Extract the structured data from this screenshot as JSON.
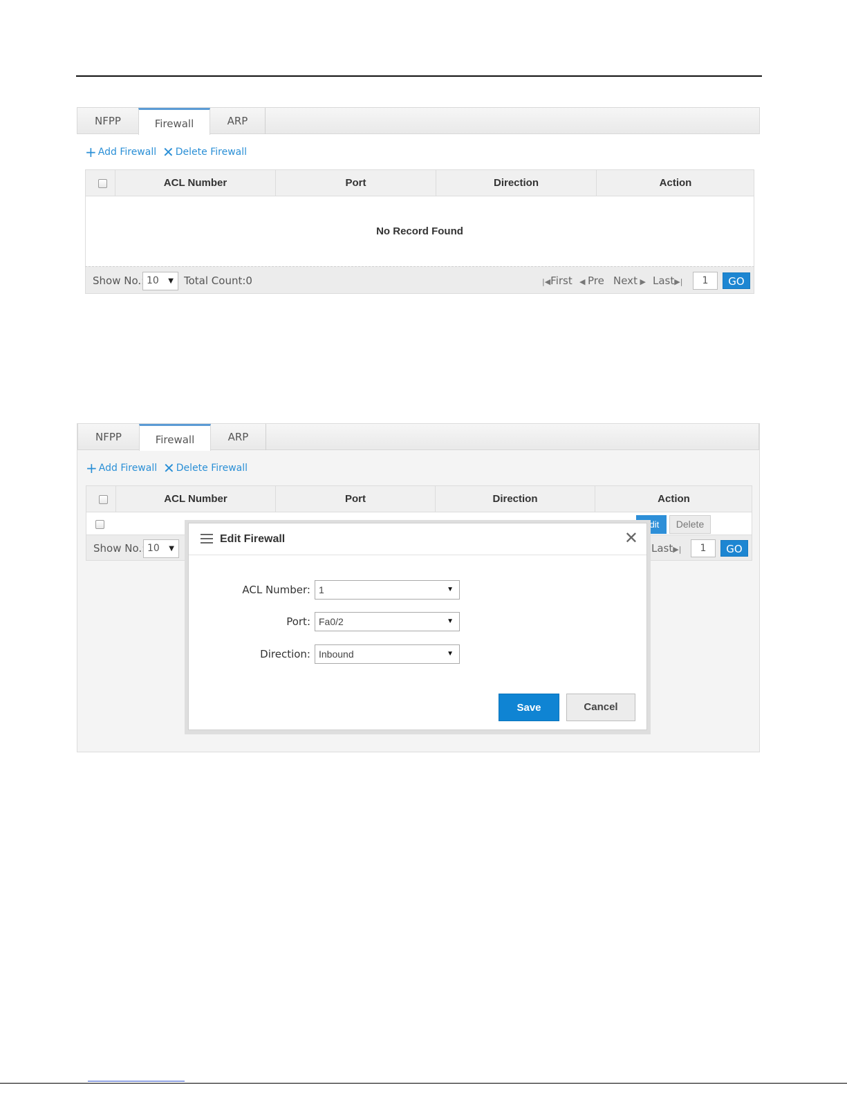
{
  "screen1": {
    "tabs": [
      "NFPP",
      "Firewall",
      "ARP"
    ],
    "active_tab": "Firewall",
    "toolbar": {
      "add_label": "Add Firewall",
      "delete_label": "Delete Firewall"
    },
    "table": {
      "columns": [
        "ACL Number",
        "Port",
        "Direction",
        "Action"
      ],
      "empty_message": "No Record Found"
    },
    "pager": {
      "show_label": "Show No.:",
      "show_value": "10",
      "total_label": "Total Count:0",
      "first": "First",
      "pre": "Pre",
      "next": "Next",
      "last": "Last",
      "page": "1",
      "go": "GO"
    }
  },
  "screen2": {
    "tabs": [
      "NFPP",
      "Firewall",
      "ARP"
    ],
    "active_tab": "Firewall",
    "toolbar": {
      "add_label": "Add Firewall",
      "delete_label": "Delete Firewall"
    },
    "table": {
      "columns": [
        "ACL Number",
        "Port",
        "Direction",
        "Action"
      ],
      "row_actions": {
        "edit": "Edit",
        "delete": "Delete"
      }
    },
    "pager": {
      "show_label": "Show No.:",
      "show_value": "10",
      "last": "Last",
      "page": "1",
      "go": "GO"
    },
    "modal": {
      "title": "Edit Firewall",
      "fields": [
        {
          "label": "ACL Number:",
          "value": "1"
        },
        {
          "label": "Port:",
          "value": "Fa0/2"
        },
        {
          "label": "Direction:",
          "value": "Inbound"
        }
      ],
      "save": "Save",
      "cancel": "Cancel"
    }
  }
}
